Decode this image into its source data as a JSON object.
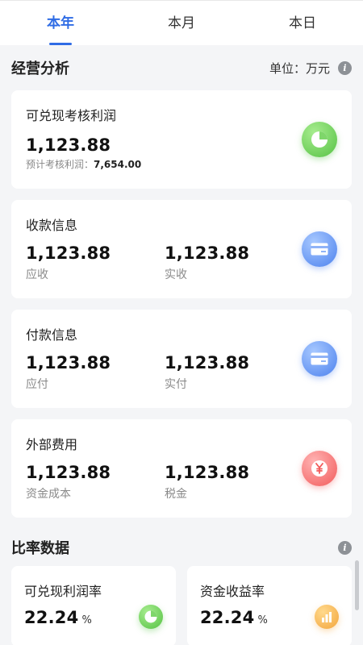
{
  "tabs": [
    "本年",
    "本月",
    "本日"
  ],
  "analysis": {
    "title": "经营分析",
    "unit": "单位：万元"
  },
  "profit_card": {
    "title": "可兑现考核利润",
    "value": "1,123.88",
    "expected_label": "预计考核利润：",
    "expected_value": "7,654.00",
    "icon": "pie-chart-icon"
  },
  "receipt_card": {
    "title": "收款信息",
    "left_value": "1,123.88",
    "left_label": "应收",
    "right_value": "1,123.88",
    "right_label": "实收",
    "icon": "card-icon"
  },
  "payment_card": {
    "title": "付款信息",
    "left_value": "1,123.88",
    "left_label": "应付",
    "right_value": "1,123.88",
    "right_label": "实付",
    "icon": "card-icon"
  },
  "expense_card": {
    "title": "外部费用",
    "left_value": "1,123.88",
    "left_label": "资金成本",
    "right_value": "1,123.88",
    "right_label": "税金",
    "icon": "yen-icon"
  },
  "ratio": {
    "title": "比率数据",
    "items": [
      {
        "title": "可兑现利润率",
        "value": "22.24",
        "unit": "%",
        "icon": "pie-chart-icon"
      },
      {
        "title": "资金收益率",
        "value": "22.24",
        "unit": "%",
        "icon": "bar-chart-icon"
      }
    ]
  },
  "colors": {
    "accent": "#2f6ce5",
    "green_icon": "#56c244",
    "blue_icon": "#4d82ee",
    "red_icon": "#f25a5a",
    "orange_icon": "#f3a53c"
  }
}
